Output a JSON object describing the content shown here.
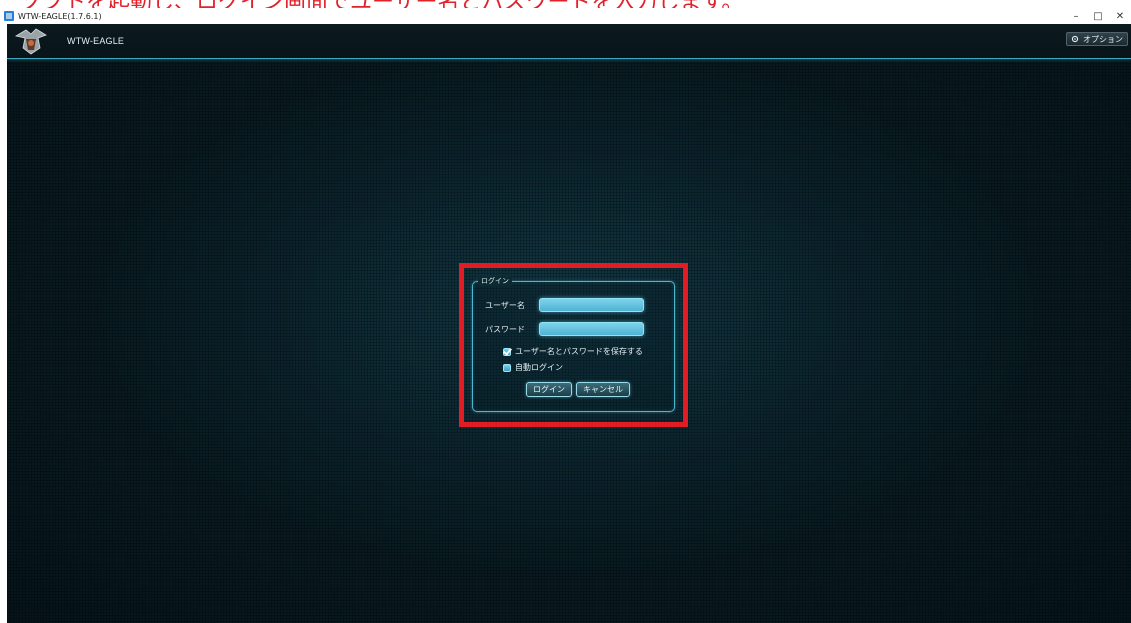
{
  "annotation": {
    "text": "ソフトを起動し、ログイン画面でユーザー名とパスワードを入力します。"
  },
  "window": {
    "title": "WTW-EAGLE(1.7.6.1)",
    "controls": {
      "minimize": "–",
      "maximize": "□",
      "close": "✕"
    }
  },
  "header": {
    "app_name": "WTW-EAGLE",
    "options_label": "オプション",
    "options_icon": "gear-icon"
  },
  "login": {
    "legend": "ログイン",
    "username_label": "ユーザー名",
    "username_value": "",
    "password_label": "パスワード",
    "password_value": "",
    "remember_label": "ユーザー名とパスワードを保存する",
    "remember_checked": true,
    "autologin_label": "自動ログイン",
    "autologin_checked": false,
    "login_button": "ログイン",
    "cancel_button": "キャンセル"
  },
  "colors": {
    "highlight": "#e11c24",
    "panel_border": "#4fb6cf",
    "input_fill": "#6cc6e2"
  }
}
